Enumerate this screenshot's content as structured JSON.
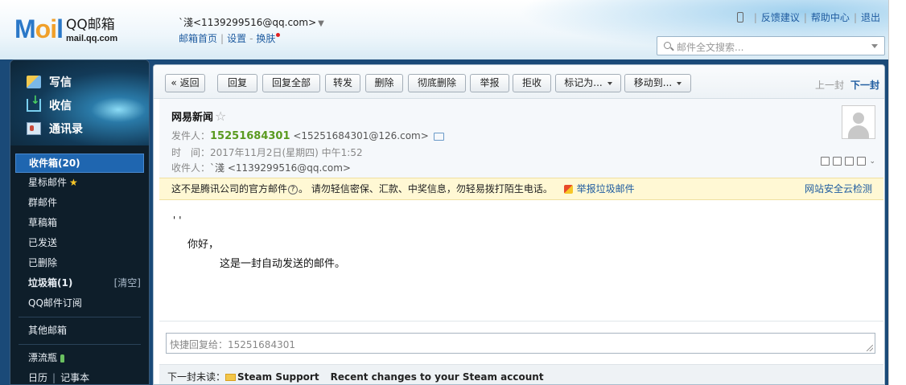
{
  "header": {
    "logo_mark": "M",
    "logo_accent": "oi",
    "logo_mark_end": "l",
    "logo_title": "QQ邮箱",
    "logo_domain": "mail.qq.com",
    "account": "`淺<1139299516@qq.com>",
    "links": {
      "home": "邮箱首页",
      "settings": "设置",
      "skin": "换肤"
    },
    "right_links": {
      "feedback": "反馈建议",
      "help": "帮助中心",
      "logout": "退出"
    },
    "search_placeholder": "邮件全文搜索..."
  },
  "sidebar": {
    "actions": {
      "write": "写信",
      "receive": "收信",
      "contacts": "通讯录"
    },
    "folders": {
      "inbox": "收件箱(20)",
      "starred": "星标邮件",
      "group": "群邮件",
      "drafts": "草稿箱",
      "sent": "已发送",
      "deleted": "已删除",
      "spam": "垃圾箱(1)",
      "spam_clear": "[清空]",
      "subscriptions": "QQ邮件订阅",
      "other": "其他邮箱",
      "bottle": "漂流瓶",
      "calendar": "日历",
      "notes": "记事本"
    }
  },
  "toolbar": {
    "back": "« 返回",
    "reply": "回复",
    "reply_all": "回复全部",
    "forward": "转发",
    "delete": "删除",
    "delete_forever": "彻底删除",
    "report": "举报",
    "reject": "拒收",
    "mark_as": "标记为...",
    "move_to": "移动到...",
    "prev": "上一封",
    "next": "下一封"
  },
  "mail": {
    "subject": "网易新闻",
    "from_label": "发件人：",
    "from_name": "15251684301",
    "from_addr": "<15251684301@126.com>",
    "time_label": "时　间：",
    "time_value": "2017年11月2日(星期四) 中午1:52",
    "to_label": "收件人：",
    "to_value": "`淺 <1139299516@qq.com>",
    "body_quote": "''",
    "body_greeting": "你好，",
    "body_line": "这是一封自动发送的邮件。"
  },
  "warning": {
    "text_a": "这不是腾讯公司的官方邮件",
    "qmark": "?",
    "text_b": "。 请勿轻信密保、汇款、中奖信息，勿轻易拨打陌生电话。",
    "report_link": "举报垃圾邮件",
    "security_link": "网站安全云检测"
  },
  "reply": {
    "placeholder": "快捷回复给：15251684301"
  },
  "next_unread": {
    "label": "下一封未读：",
    "from": "Steam Support",
    "subject": "Recent changes to your Steam account"
  }
}
